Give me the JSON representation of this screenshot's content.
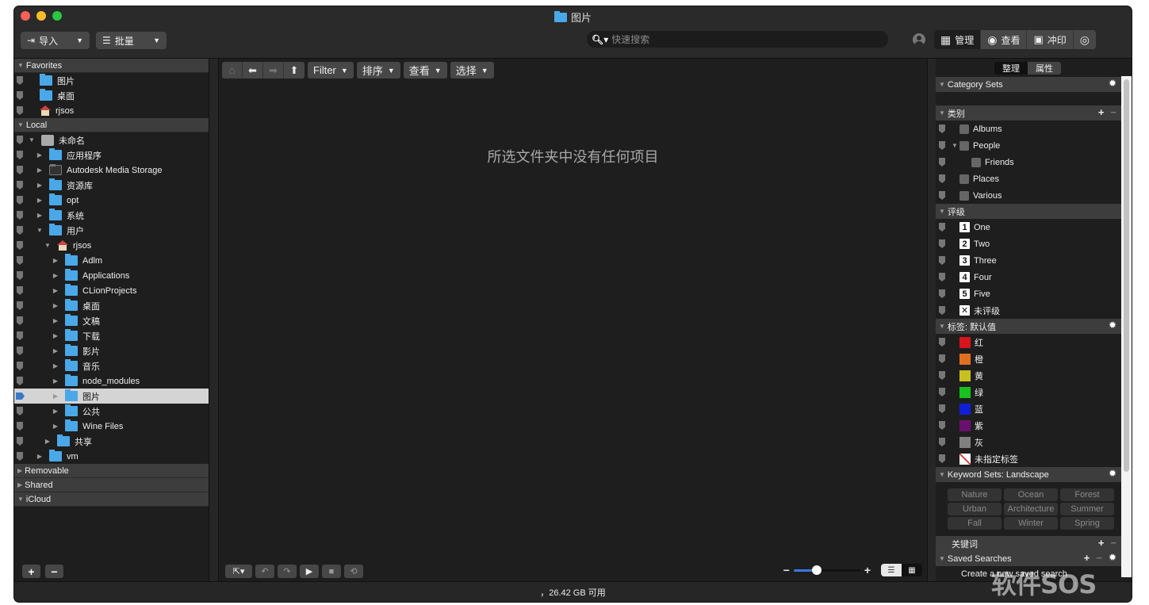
{
  "window": {
    "title": "图片",
    "title_icon": "pictures-folder-icon"
  },
  "toolbar": {
    "import_label": "导入",
    "import_icon": "import-icon",
    "batch_label": "批量",
    "batch_icon": "batch-icon",
    "search_placeholder": "快速搜索",
    "search_value": "",
    "modes": [
      {
        "label": "管理",
        "icon": "grid-icon",
        "active": true
      },
      {
        "label": "查看",
        "icon": "eye-icon",
        "active": false
      },
      {
        "label": "冲印",
        "icon": "develop-icon",
        "active": false
      },
      {
        "label": "",
        "icon": "eye-cycle-icon",
        "active": false
      }
    ]
  },
  "left_panel": {
    "sections": {
      "favorites": "Favorites",
      "local": "Local",
      "removable": "Removable",
      "shared": "Shared",
      "icloud": "iCloud"
    },
    "favorites": [
      {
        "label": "图片",
        "icon": "pictures-folder-icon"
      },
      {
        "label": "桌面",
        "icon": "desktop-folder-icon"
      },
      {
        "label": "rjsos",
        "icon": "home-icon"
      }
    ],
    "local": [
      {
        "label": "未命名",
        "icon": "hard-disk-icon",
        "level": 0,
        "expanded": true
      },
      {
        "label": "应用程序",
        "icon": "applications-folder-icon",
        "level": 1
      },
      {
        "label": "Autodesk Media Storage",
        "icon": "dark-folder-icon",
        "level": 1
      },
      {
        "label": "资源库",
        "icon": "library-folder-icon",
        "level": 1
      },
      {
        "label": "opt",
        "icon": "folder-icon",
        "level": 1
      },
      {
        "label": "系统",
        "icon": "system-folder-icon",
        "level": 1
      },
      {
        "label": "用户",
        "icon": "users-folder-icon",
        "level": 1,
        "expanded": true
      },
      {
        "label": "rjsos",
        "icon": "home-icon",
        "level": 2,
        "expanded": true
      },
      {
        "label": "Adlm",
        "icon": "folder-icon",
        "level": 3
      },
      {
        "label": "Applications",
        "icon": "applications-folder-icon",
        "level": 3
      },
      {
        "label": "CLionProjects",
        "icon": "folder-icon",
        "level": 3
      },
      {
        "label": "桌面",
        "icon": "desktop-folder-icon",
        "level": 3
      },
      {
        "label": "文稿",
        "icon": "documents-folder-icon",
        "level": 3
      },
      {
        "label": "下载",
        "icon": "downloads-folder-icon",
        "level": 3
      },
      {
        "label": "影片",
        "icon": "movies-folder-icon",
        "level": 3
      },
      {
        "label": "音乐",
        "icon": "music-folder-icon",
        "level": 3
      },
      {
        "label": "node_modules",
        "icon": "folder-icon",
        "level": 3
      },
      {
        "label": "图片",
        "icon": "pictures-folder-icon",
        "level": 3,
        "selected": true
      },
      {
        "label": "公共",
        "icon": "public-folder-icon",
        "level": 3
      },
      {
        "label": "Wine Files",
        "icon": "folder-icon",
        "level": 3
      },
      {
        "label": "共享",
        "icon": "folder-icon",
        "level": 2
      },
      {
        "label": "vm",
        "icon": "folder-icon",
        "level": 1
      }
    ],
    "add_label": "+",
    "remove_label": "−"
  },
  "center": {
    "filter_label": "Filter",
    "sort_label": "排序",
    "view_label": "查看",
    "select_label": "选择",
    "empty_message": "所选文件夹中没有任何项目",
    "thumbnail_size": 0.35
  },
  "right_panel": {
    "tabs": [
      {
        "label": "整理",
        "active": false
      },
      {
        "label": "属性",
        "active": true
      }
    ],
    "category_sets_title": "Category Sets",
    "categories_title": "类别",
    "categories": [
      {
        "label": "Albums",
        "indent": 0,
        "has_disclosure": false
      },
      {
        "label": "People",
        "indent": 0,
        "has_disclosure": true
      },
      {
        "label": "Friends",
        "indent": 1,
        "has_disclosure": false
      },
      {
        "label": "Places",
        "indent": 0,
        "has_disclosure": false
      },
      {
        "label": "Various",
        "indent": 0,
        "has_disclosure": false
      }
    ],
    "ratings_title": "评级",
    "ratings": [
      {
        "badge": "1",
        "label": "One"
      },
      {
        "badge": "2",
        "label": "Two"
      },
      {
        "badge": "3",
        "label": "Three"
      },
      {
        "badge": "4",
        "label": "Four"
      },
      {
        "badge": "5",
        "label": "Five"
      },
      {
        "badge": "✕",
        "label": "未评级"
      }
    ],
    "labels_title": "标签: 默认值",
    "labels": [
      {
        "label": "红",
        "color": "#d8141c"
      },
      {
        "label": "橙",
        "color": "#e07020"
      },
      {
        "label": "黄",
        "color": "#c8c020"
      },
      {
        "label": "绿",
        "color": "#18c020"
      },
      {
        "label": "蓝",
        "color": "#1020d8"
      },
      {
        "label": "紫",
        "color": "#6a1070"
      },
      {
        "label": "灰",
        "color": "#808080"
      },
      {
        "label": "未指定标签",
        "color": "none"
      }
    ],
    "keyword_sets_title": "Keyword Sets: Landscape",
    "keyword_sets": [
      "Nature",
      "Ocean",
      "Forest",
      "Urban",
      "Architecture",
      "Summer",
      "Fall",
      "Winter",
      "Spring"
    ],
    "keywords_title": "关键词",
    "saved_searches_title": "Saved Searches",
    "saved_searches_item": "Create a new saved search"
  },
  "status_bar": {
    "text": "，26.42 GB 可用"
  },
  "watermark": "软件SOS"
}
